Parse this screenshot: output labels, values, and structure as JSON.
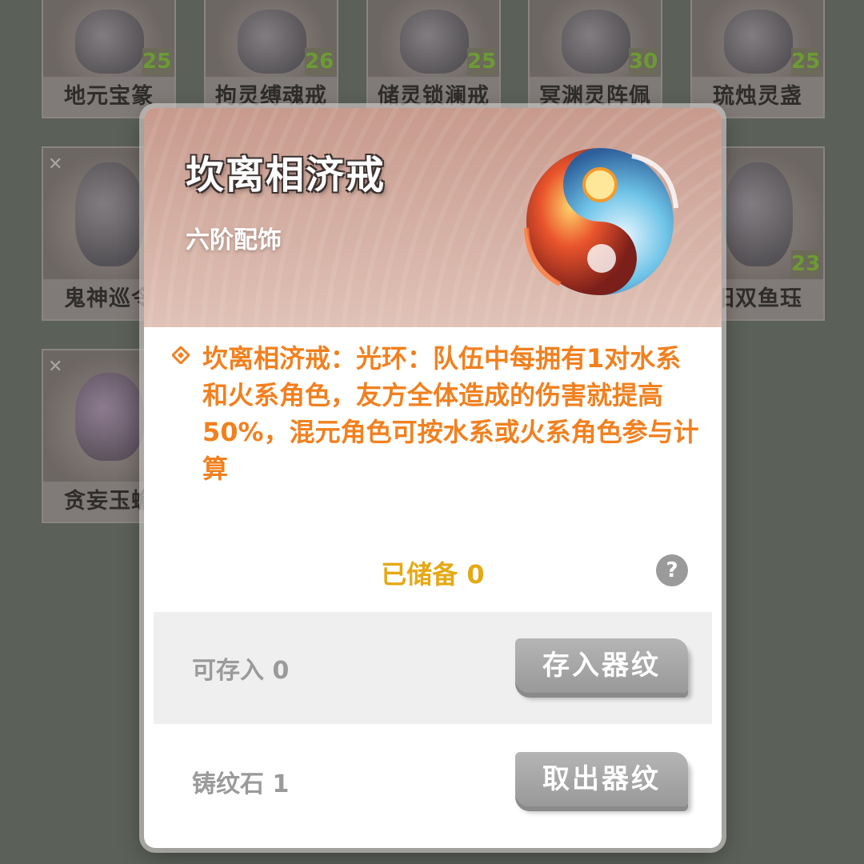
{
  "grid": {
    "items": [
      {
        "name": "地元宝篆",
        "level": "25"
      },
      {
        "name": "拘灵缚魂戒",
        "level": "26"
      },
      {
        "name": "储灵锁澜戒",
        "level": "25"
      },
      {
        "name": "冥渊灵阵佩",
        "level": "30"
      },
      {
        "name": "琉烛灵盏",
        "level": "25"
      },
      {
        "name": "鬼神巡令",
        "level": ""
      },
      {
        "name": "阳双鱼珏",
        "level": "23"
      },
      {
        "name": "贪妄玉蟾",
        "level": ""
      }
    ]
  },
  "modal": {
    "title": "坎离相济戒",
    "subtitle": "六阶配饰",
    "description": "坎离相济戒：光环：队伍中每拥有1对水系和火系角色，友方全体造成的伤害就提高50%，混元角色可按水系或火系角色参与计算",
    "stored_text": "已储备 0",
    "help_symbol": "?",
    "deposit": {
      "label": "可存入 0",
      "button": "存入器纹"
    },
    "withdraw": {
      "label": "铸纹石 1",
      "button": "取出器纹"
    }
  },
  "colors": {
    "accent_orange": "#f1801f",
    "stored_gold": "#e4a914",
    "button_gray": "#a8a8a8",
    "level_green": "#6d9a35"
  },
  "icons": {
    "lock": "lock-icon",
    "help": "help-icon",
    "diamond": "diamond-bullet-icon",
    "item": "ring-art-icon"
  }
}
